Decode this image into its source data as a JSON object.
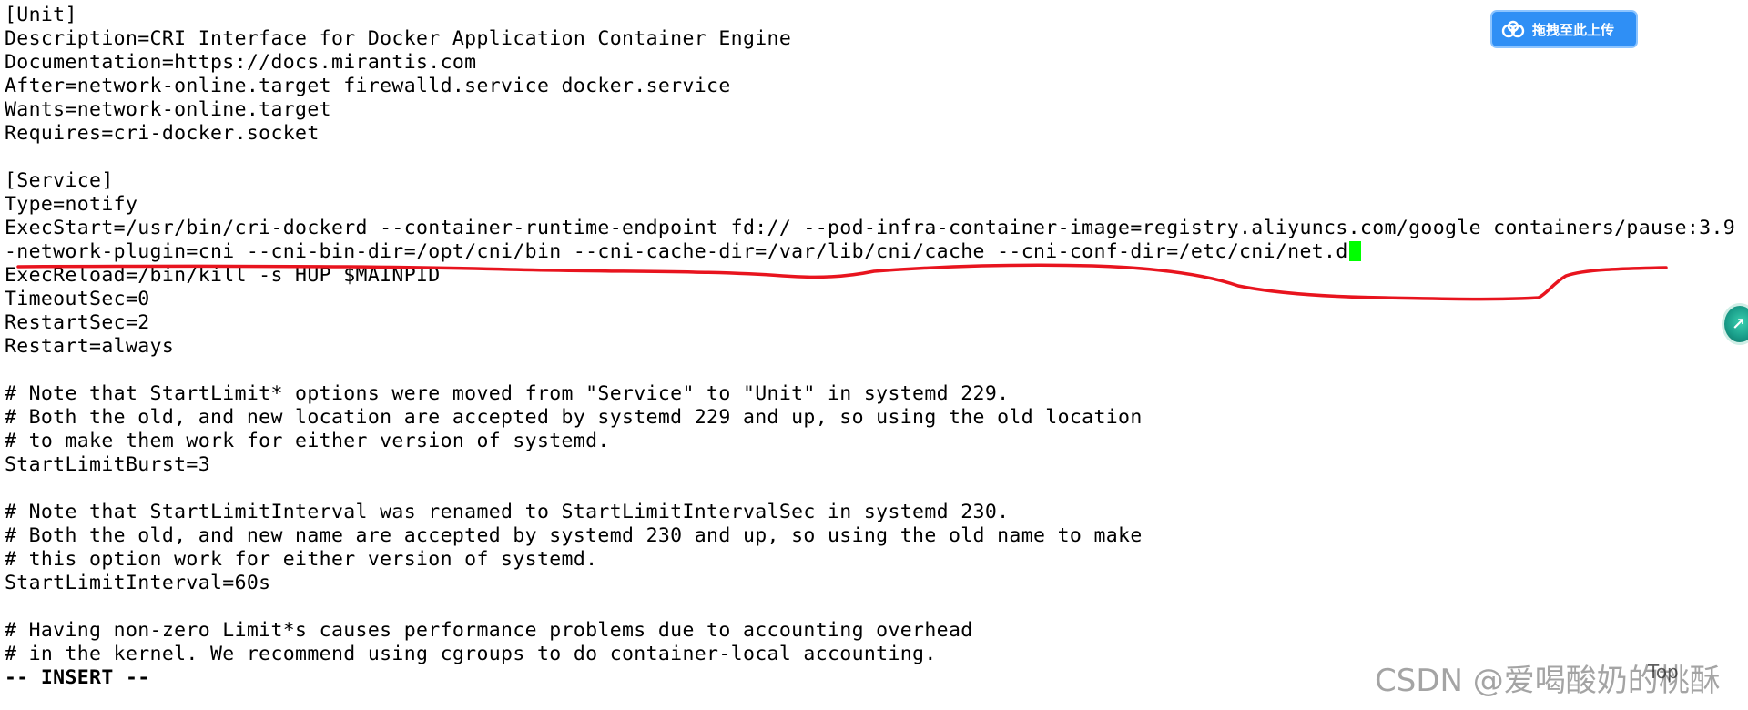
{
  "terminal": {
    "lines": [
      "[Unit]",
      "Description=CRI Interface for Docker Application Container Engine",
      "Documentation=https://docs.mirantis.com",
      "After=network-online.target firewalld.service docker.service",
      "Wants=network-online.target",
      "Requires=cri-docker.socket",
      "",
      "[Service]",
      "Type=notify",
      "ExecStart=/usr/bin/cri-dockerd --container-runtime-endpoint fd:// --pod-infra-container-image=registry.aliyuncs.com/google_containers/pause:3.9 -",
      "-network-plugin=cni --cni-bin-dir=/opt/cni/bin --cni-cache-dir=/var/lib/cni/cache --cni-conf-dir=/etc/cni/net.d",
      "ExecReload=/bin/kill -s HUP $MAINPID",
      "TimeoutSec=0",
      "RestartSec=2",
      "Restart=always",
      "",
      "# Note that StartLimit* options were moved from \"Service\" to \"Unit\" in systemd 229.",
      "# Both the old, and new location are accepted by systemd 229 and up, so using the old location",
      "# to make them work for either version of systemd.",
      "StartLimitBurst=3",
      "",
      "# Note that StartLimitInterval was renamed to StartLimitIntervalSec in systemd 230.",
      "# Both the old, and new name are accepted by systemd 230 and up, so using the old name to make",
      "# this option work for either version of systemd.",
      "StartLimitInterval=60s",
      "",
      "# Having non-zero Limit*s causes performance problems due to accounting overhead",
      "# in the kernel. We recommend using cgroups to do container-local accounting."
    ],
    "mode_line": "-- INSERT --",
    "cursor_color": "#00ff00",
    "annotation_color": "#e8141e"
  },
  "upload_widget": {
    "label": "拖拽至此上传",
    "icon": "cloud-upload-icon",
    "color": "#2f8ff5"
  },
  "edge_widget": {
    "icon": "floating-assistant-icon"
  },
  "watermark": {
    "text": "CSDN @爱喝酸奶的桃酥",
    "fragment": "Top"
  }
}
